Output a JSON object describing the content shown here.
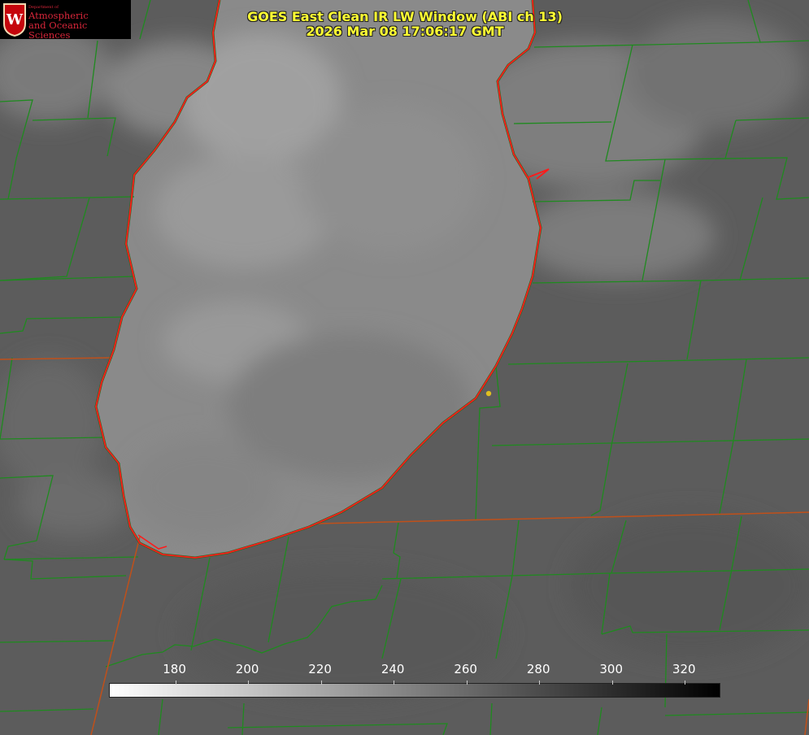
{
  "title": {
    "line1": "GOES East Clean IR LW Window (ABI ch 13)",
    "line2": "2026 Mar 08 17:06:17 GMT"
  },
  "logo": {
    "small": "Department of",
    "line1": "Atmospheric",
    "line2": "and Oceanic Sciences",
    "seal_letter": "W"
  },
  "colorbar": {
    "ticks": [
      "180",
      "200",
      "220",
      "240",
      "260",
      "280",
      "300",
      "320"
    ],
    "min": 162,
    "max": 330,
    "colors": {
      "low": "#ffffff",
      "high": "#000000"
    }
  },
  "colors": {
    "county_border": "#1f8a1f",
    "state_border": "#c0501a",
    "coastline": "#ff1a1a",
    "title_text": "#ffff33",
    "marker": "#e0c020"
  }
}
